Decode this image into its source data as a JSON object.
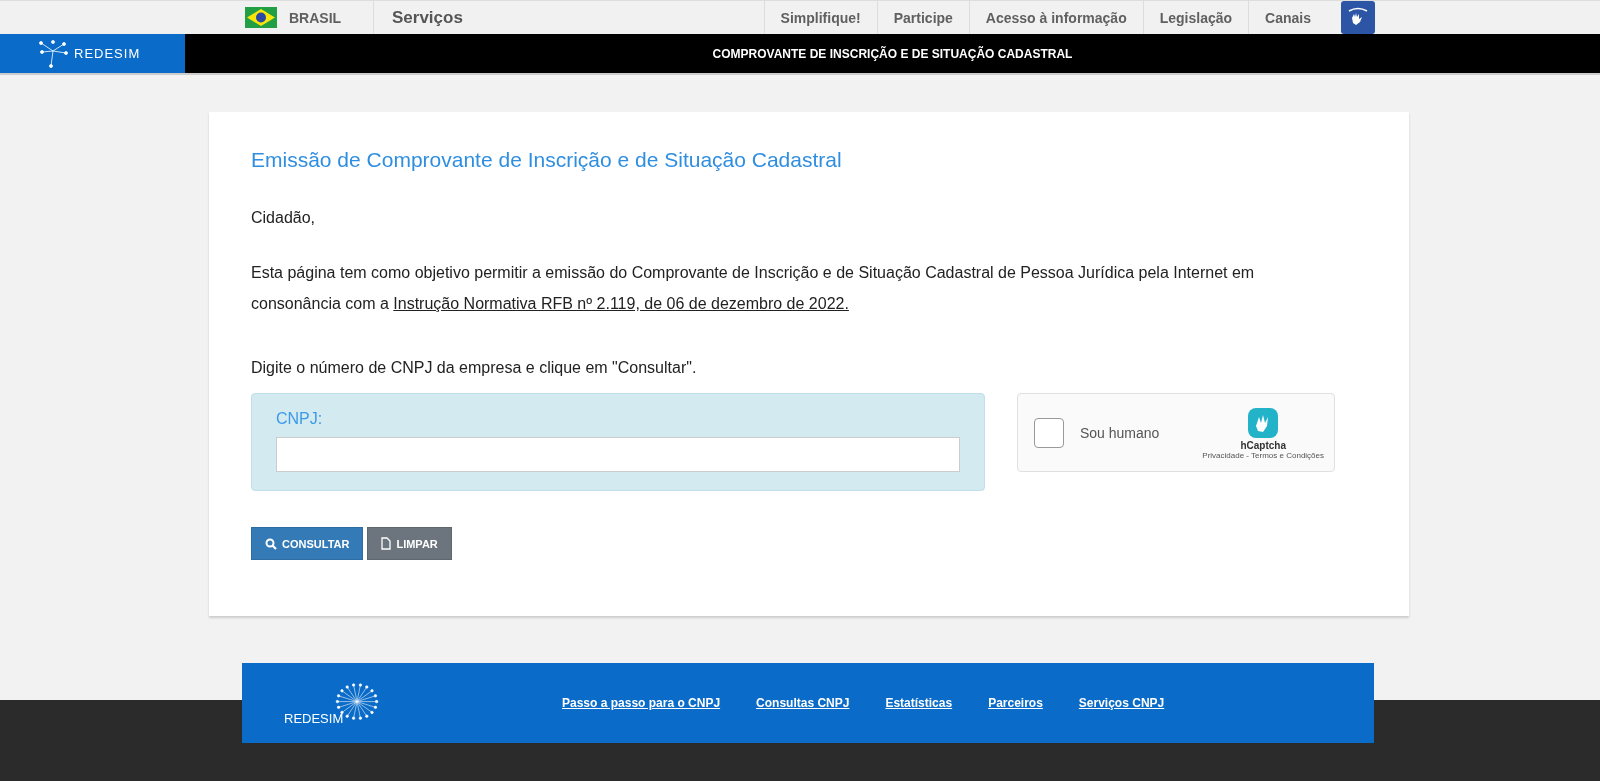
{
  "gov_bar": {
    "country": "BRASIL",
    "services": "Serviços",
    "links": [
      "Simplifique!",
      "Participe",
      "Acesso à informação",
      "Legislação",
      "Canais"
    ]
  },
  "header": {
    "logo": "REDESIM",
    "title": "COMPROVANTE DE INSCRIÇÃO E DE SITUAÇÃO CADASTRAL"
  },
  "card": {
    "title": "Emissão de Comprovante de Inscrição e de Situação Cadastral",
    "greeting": "Cidadão,",
    "intro": "Esta página tem como objetivo permitir a emissão do Comprovante de Inscrição e de Situação Cadastral de Pessoa Jurídica pela Internet em consonância com a",
    "intro_link": "Instrução Normativa RFB nº 2.119, de 06 de dezembro de 2022.",
    "instruction": "Digite o número de CNPJ da empresa e clique em \"Consultar\".",
    "field_label": "CNPJ:",
    "captcha": {
      "checked": false,
      "label": "Sou humano",
      "brand": "hCaptcha",
      "terms": "Privacidade - Termos e Condições"
    },
    "buttons": [
      {
        "kind": "primary",
        "label": "CONSULTAR"
      },
      {
        "kind": "secondary",
        "label": "LIMPAR"
      }
    ]
  },
  "footer": {
    "logo": "REDESIM",
    "links": [
      "Passo a passo para o CNPJ",
      "Consultas CNPJ",
      "Estatísticas",
      "Parceiros",
      "Serviços CNPJ"
    ]
  }
}
